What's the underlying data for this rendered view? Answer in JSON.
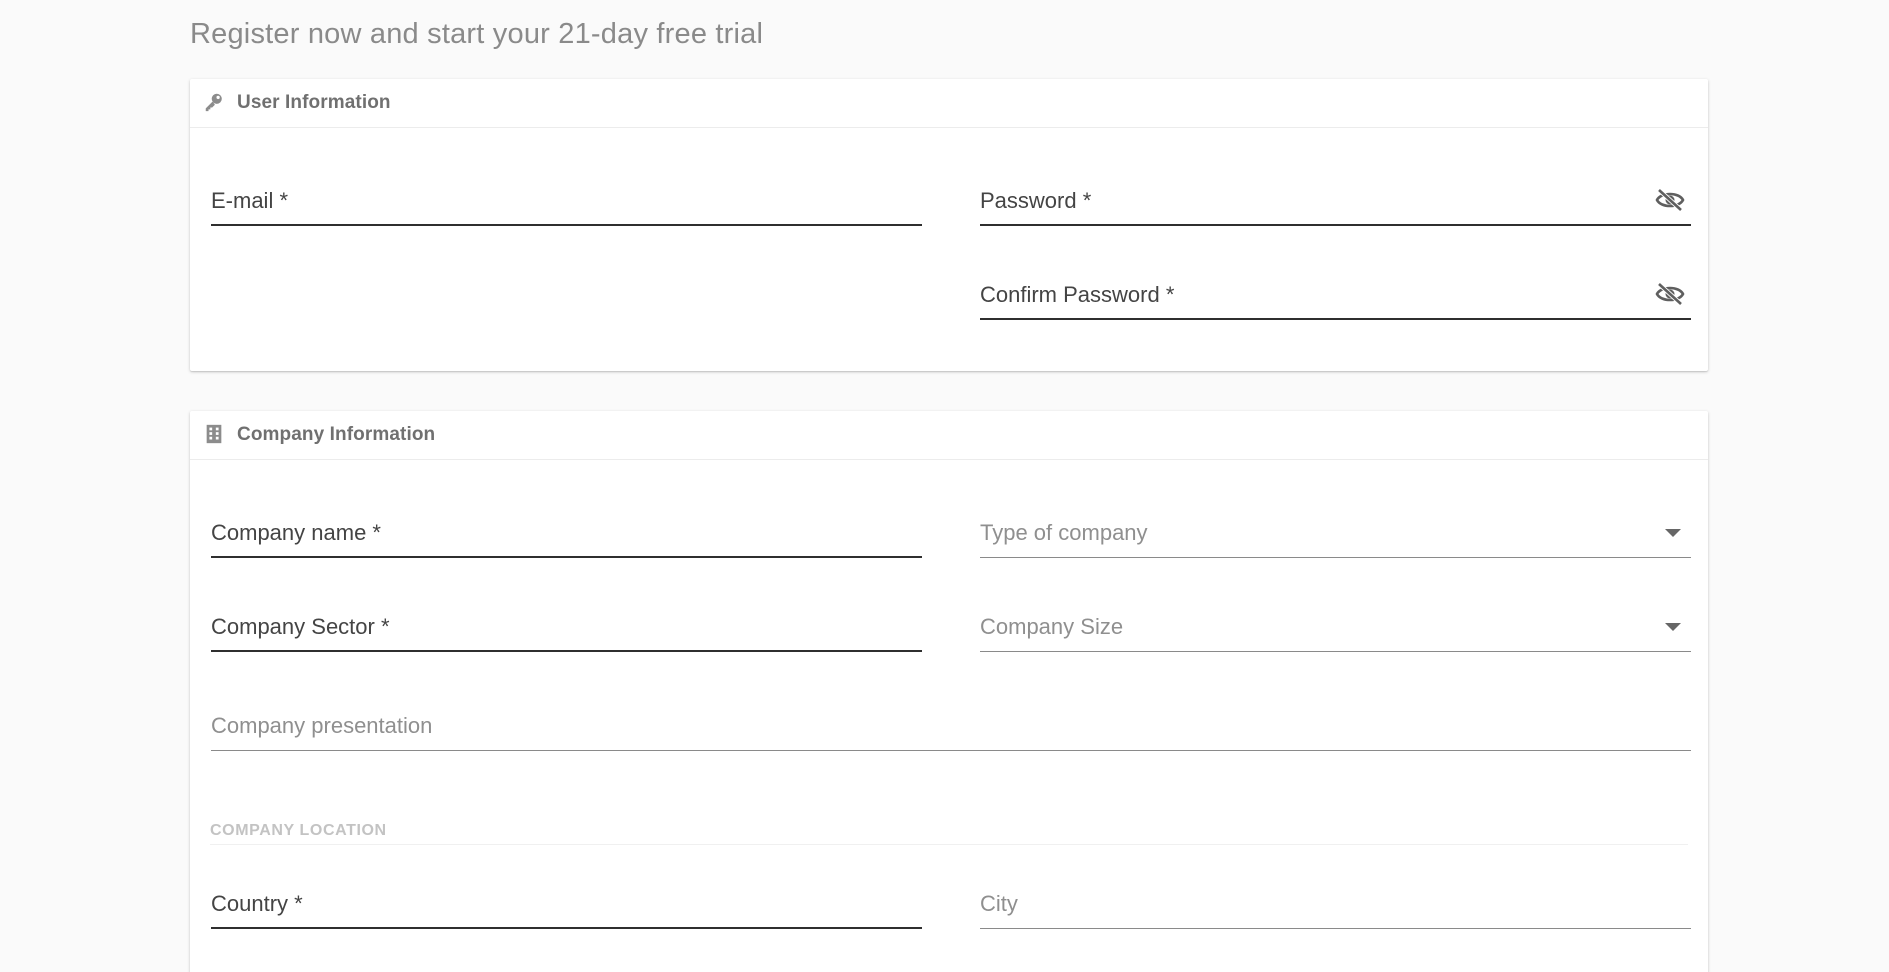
{
  "page_title": "Register now and start your 21-day free trial",
  "user_info": {
    "title": "User Information",
    "icon": "key-icon",
    "fields": {
      "email": {
        "label": "E-mail *"
      },
      "password": {
        "label": "Password *",
        "toggle_icon": "visibility-off-icon"
      },
      "confirm_password": {
        "label": "Confirm Password *",
        "toggle_icon": "visibility-off-icon"
      }
    }
  },
  "company_info": {
    "title": "Company Information",
    "icon": "building-icon",
    "fields": {
      "company_name": {
        "label": "Company name *"
      },
      "type_of_company": {
        "label": "Type of company",
        "dropdown_icon": "caret-down-icon"
      },
      "company_sector": {
        "label": "Company Sector *"
      },
      "company_size": {
        "label": "Company Size",
        "dropdown_icon": "caret-down-icon"
      },
      "company_presentation": {
        "label": "Company presentation"
      }
    },
    "location_section": {
      "title": "COMPANY LOCATION",
      "fields": {
        "country": {
          "label": "Country *"
        },
        "city": {
          "label": "City"
        }
      }
    }
  },
  "colors": {
    "background": "#fafafa",
    "card": "#ffffff",
    "required_underline": "#2f2f2f",
    "optional_underline": "#8a8a8a",
    "muted_text": "#8f8f8f"
  }
}
